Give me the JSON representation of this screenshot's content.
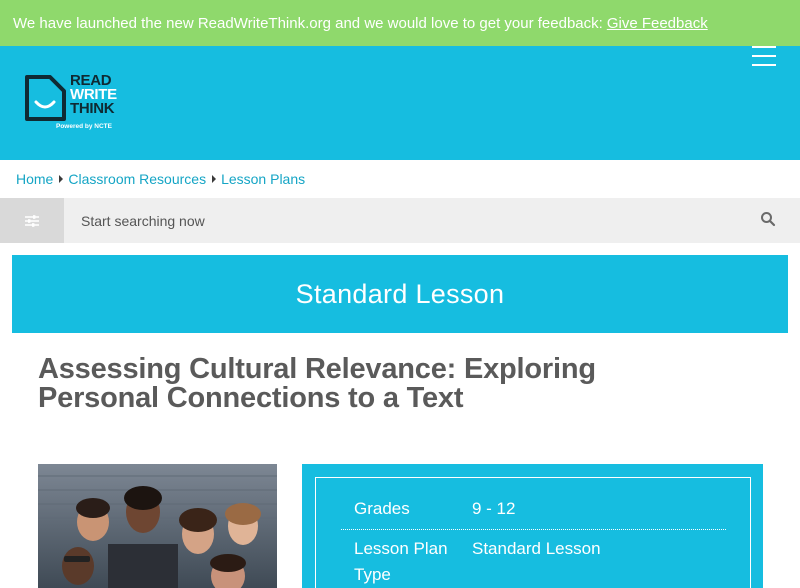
{
  "announcement": {
    "text": "We have launched the new ReadWriteThink.org and we would love to get your feedback:",
    "link": "Give Feedback"
  },
  "logo": {
    "line1": "READ",
    "line2": "WRITE",
    "line3": "THINK",
    "tagline": "Powered by NCTE"
  },
  "breadcrumb": [
    "Home",
    "Classroom Resources",
    "Lesson Plans"
  ],
  "search": {
    "placeholder": "Start searching now"
  },
  "banner": "Standard Lesson",
  "title": "Assessing Cultural Relevance: Exploring Personal Connections to a Text",
  "info": {
    "grades_label": "Grades",
    "grades_value": "9 - 12",
    "type_label": "Lesson Plan Type",
    "type_value": "Standard Lesson"
  },
  "colors": {
    "announcement_bg": "#8fd96c",
    "brand_blue": "#16bde0",
    "link_blue": "#15a5c5",
    "title_gray": "#5a5a5a"
  },
  "icons": [
    "hamburger-menu-icon",
    "filter-sliders-icon",
    "search-icon"
  ]
}
